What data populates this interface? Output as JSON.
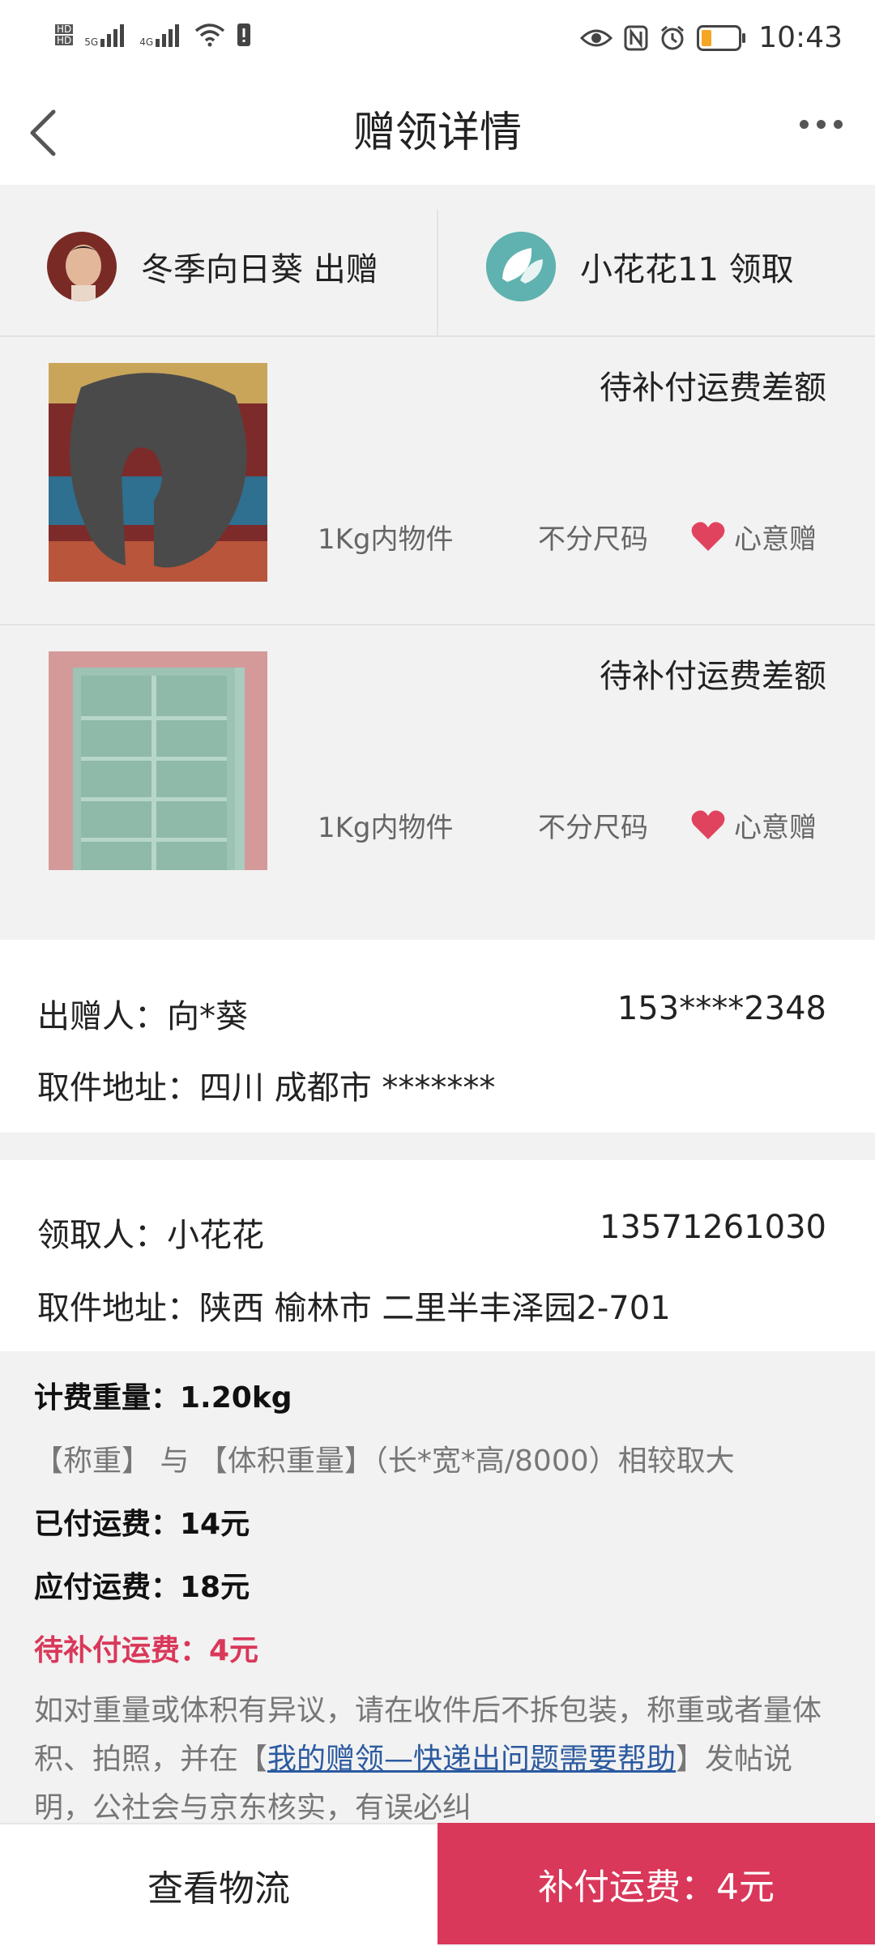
{
  "status_bar": {
    "time": "10:43",
    "hd1": "HD",
    "hd2": "HD",
    "net1": "5G",
    "net2": "4G"
  },
  "header": {
    "title": "赠领详情"
  },
  "people": {
    "giver_label": "冬季向日葵 出赠",
    "receiver_label": "小花花11 领取"
  },
  "items": [
    {
      "status": "待补付运费差额",
      "weight": "1Kg内物件",
      "size": "不分尺码",
      "type": "心意赠"
    },
    {
      "status": "待补付运费差额",
      "weight": "1Kg内物件",
      "size": "不分尺码",
      "type": "心意赠"
    }
  ],
  "sender": {
    "name_line": "出赠人：向*葵",
    "phone": "153****2348",
    "address_line": "取件地址：四川 成都市 *******"
  },
  "receiver": {
    "name_line": "领取人：小花花",
    "phone": "13571261030",
    "address_line": "取件地址：陕西 榆林市 二里半丰泽园2-701"
  },
  "fees": {
    "billing_weight": "计费重量：1.20kg",
    "weight_rule": "【称重】 与 【体积重量】（长*宽*高/8000）相较取大",
    "paid": "已付运费：14元",
    "due": "应付运费：18元",
    "pending": "待补付运费：4元",
    "note_prefix": "如对重量或体积有异议，请在收件后不拆包装，称重或者量体积、拍照，并在【",
    "note_link": "我的赠领—快递出问题需要帮助",
    "note_suffix": "】发帖说明，公社会与京东核实，有误必纠"
  },
  "bottom_bar": {
    "logistics_button": "查看物流",
    "pay_button": "补付运费：4元"
  },
  "colors": {
    "accent": "#d9385a",
    "link": "#2c5aa0",
    "receiver_avatar": "#5fb2b0"
  }
}
